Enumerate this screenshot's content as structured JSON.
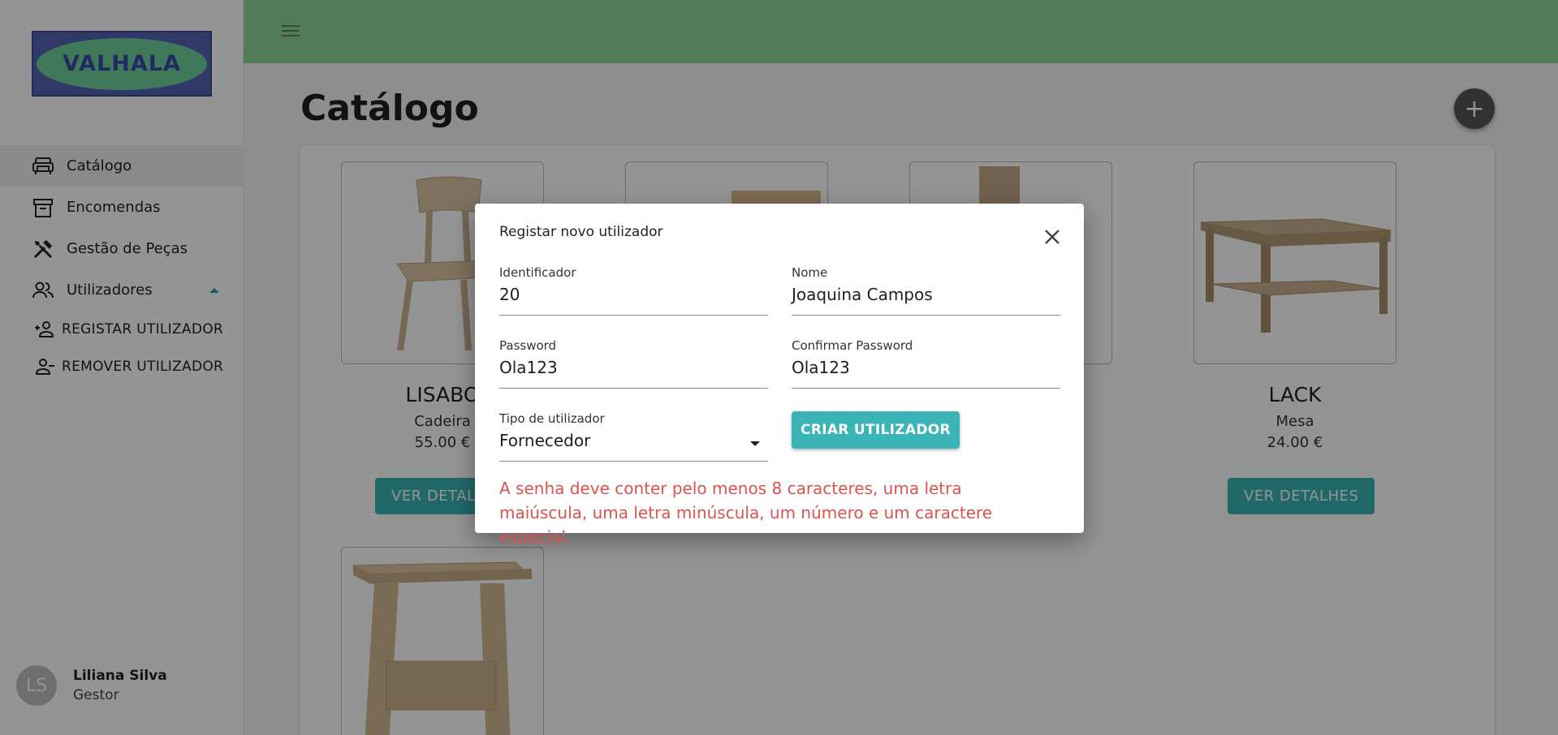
{
  "logo": {
    "text": "VALHALA"
  },
  "sidebar": {
    "items": [
      {
        "label": "Catálogo",
        "icon": "sofa-icon",
        "active": true
      },
      {
        "label": "Encomendas",
        "icon": "archive-icon"
      },
      {
        "label": "Gestão de Peças",
        "icon": "tools-icon"
      },
      {
        "label": "Utilizadores",
        "icon": "users-icon",
        "expanded": true
      }
    ],
    "subitems": [
      {
        "label": "REGISTAR UTILIZADOR",
        "icon": "person-add-icon"
      },
      {
        "label": "REMOVER UTILIZADOR",
        "icon": "person-remove-icon"
      }
    ],
    "user": {
      "initials": "LS",
      "name": "Liliana Silva",
      "role": "Gestor"
    }
  },
  "header": {
    "menu_icon": "menu-icon"
  },
  "page": {
    "title": "Catálogo",
    "add_label": "+"
  },
  "products": [
    {
      "name": "LISABO",
      "type": "Cadeira",
      "price": "55.00 €",
      "button": "VER DETALHES"
    },
    {
      "name": "",
      "type": "",
      "price": "",
      "button": ""
    },
    {
      "name": "",
      "type": "",
      "price": "",
      "button": ""
    },
    {
      "name": "LACK",
      "type": "Mesa",
      "price": "24.00 €",
      "button": "VER DETALHES"
    },
    {
      "name": "",
      "type": "",
      "price": "",
      "button": ""
    }
  ],
  "modal": {
    "title": "Registar novo utilizador",
    "fields": {
      "id": {
        "label": "Identificador",
        "value": "20"
      },
      "name": {
        "label": "Nome",
        "value": "Joaquina Campos"
      },
      "password": {
        "label": "Password",
        "value": "Ola123"
      },
      "confirm": {
        "label": "Confirmar Password",
        "value": "Ola123"
      },
      "type": {
        "label": "Tipo de utilizador",
        "value": "Fornecedor"
      }
    },
    "create_label": "CRIAR UTILIZADOR",
    "error": "A senha deve conter pelo menos 8 caracteres, uma letra maiúscula, uma letra minúscula, um número e um caractere especial."
  },
  "colors": {
    "accent": "#3ab4b6",
    "topbar": "#8ed694",
    "error": "#d9534f"
  }
}
